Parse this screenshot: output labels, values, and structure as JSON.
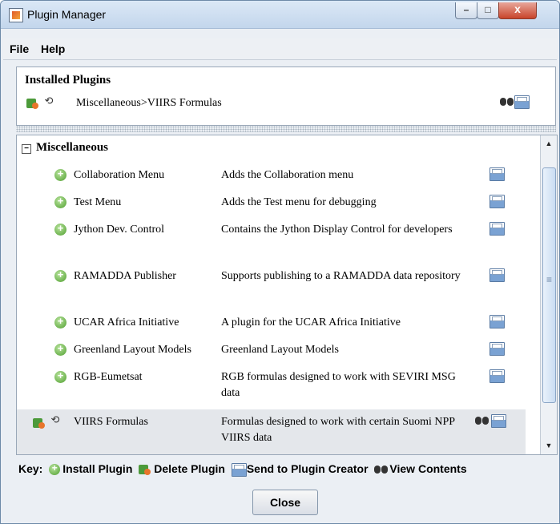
{
  "window": {
    "title": "Plugin Manager"
  },
  "menubar": {
    "items": [
      "File",
      "Help"
    ]
  },
  "installed": {
    "title": "Installed Plugins",
    "items": [
      {
        "path": "Miscellaneous>VIIRS Formulas"
      }
    ]
  },
  "list": {
    "group": "Miscellaneous",
    "rows": [
      {
        "name": "Collaboration Menu",
        "desc": "Adds the Collaboration menu",
        "installed": false
      },
      {
        "name": "Test Menu",
        "desc": "Adds the Test menu for debugging",
        "installed": false
      },
      {
        "name": "Jython Dev. Control",
        "desc": "Contains the Jython Display Control for developers",
        "installed": false
      },
      {
        "name": "RAMADDA Publisher",
        "desc": "Supports publishing to a RAMADDA data repository",
        "installed": false
      },
      {
        "name": "UCAR Africa Initiative",
        "desc": "A plugin for the UCAR Africa Initiative",
        "installed": false
      },
      {
        "name": "Greenland Layout Models",
        "desc": "Greenland Layout Models",
        "installed": false
      },
      {
        "name": "RGB-Eumetsat",
        "desc": "RGB formulas designed to work with SEVIRI MSG data",
        "installed": false
      },
      {
        "name": "VIIRS Formulas",
        "desc": "Formulas designed to work with certain Suomi NPP VIIRS data",
        "installed": true
      }
    ]
  },
  "key": {
    "label": "Key:",
    "install": "Install Plugin",
    "delete": "Delete Plugin",
    "send": "Send to Plugin Creator",
    "view": "View Contents"
  },
  "buttons": {
    "close": "Close"
  }
}
